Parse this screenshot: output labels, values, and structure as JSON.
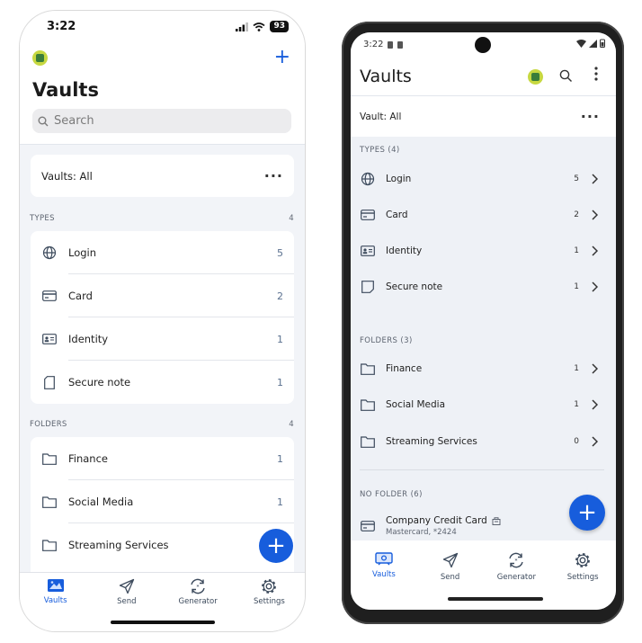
{
  "ios": {
    "time": "3:22",
    "battery": "93",
    "title": "Vaults",
    "search_placeholder": "Search",
    "vault_filter": "Vaults: All",
    "types_label": "TYPES",
    "types_count": "4",
    "types": [
      {
        "label": "Login",
        "count": "5",
        "icon": "globe-icon"
      },
      {
        "label": "Card",
        "count": "2",
        "icon": "card-icon"
      },
      {
        "label": "Identity",
        "count": "1",
        "icon": "id-card-icon"
      },
      {
        "label": "Secure note",
        "count": "1",
        "icon": "note-icon"
      }
    ],
    "folders_label": "FOLDERS",
    "folders_count": "4",
    "folders": [
      {
        "label": "Finance",
        "count": "1"
      },
      {
        "label": "Social Media",
        "count": "1"
      },
      {
        "label": "Streaming Services",
        "count": ""
      }
    ],
    "tabs": [
      {
        "label": "Vaults",
        "icon": "vault-icon"
      },
      {
        "label": "Send",
        "icon": "send-icon"
      },
      {
        "label": "Generator",
        "icon": "generator-icon"
      },
      {
        "label": "Settings",
        "icon": "gear-icon"
      }
    ]
  },
  "android": {
    "time": "3:22",
    "title": "Vaults",
    "vault_filter": "Vault: All",
    "types_label": "TYPES (4)",
    "types": [
      {
        "label": "Login",
        "count": "5"
      },
      {
        "label": "Card",
        "count": "2"
      },
      {
        "label": "Identity",
        "count": "1"
      },
      {
        "label": "Secure note",
        "count": "1"
      }
    ],
    "folders_label": "FOLDERS (3)",
    "folders": [
      {
        "label": "Finance",
        "count": "1"
      },
      {
        "label": "Social Media",
        "count": "1"
      },
      {
        "label": "Streaming Services",
        "count": "0"
      }
    ],
    "no_folder_label": "NO FOLDER (6)",
    "no_folder_item": {
      "title": "Company Credit Card",
      "subtitle": "Mastercard, *2424"
    },
    "tabs": [
      {
        "label": "Vaults"
      },
      {
        "label": "Send"
      },
      {
        "label": "Generator"
      },
      {
        "label": "Settings"
      }
    ]
  },
  "colors": {
    "accent": "#175ddc",
    "avatar": "#c7d841"
  }
}
